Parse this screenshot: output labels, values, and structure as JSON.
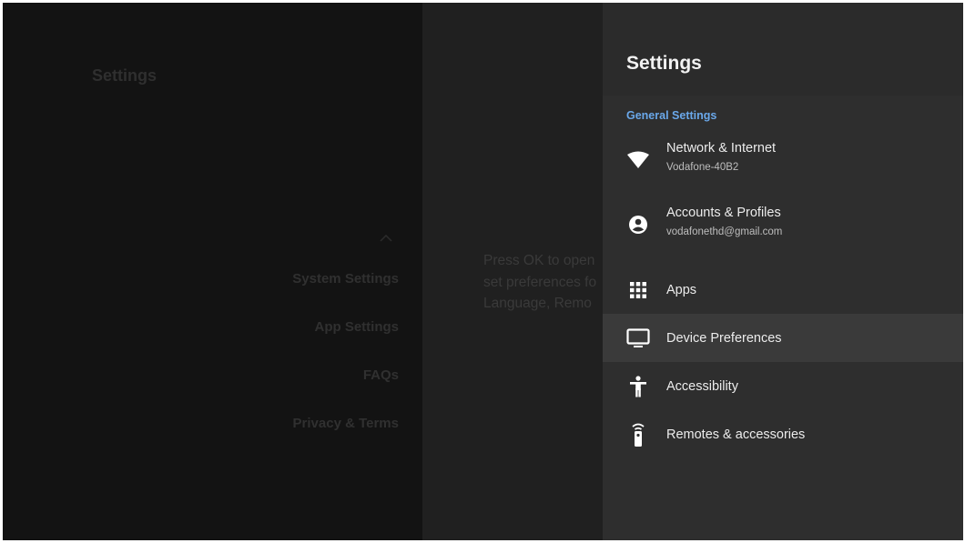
{
  "background": {
    "title": "Settings",
    "menu": [
      {
        "label": "System Settings"
      },
      {
        "label": "App Settings"
      },
      {
        "label": "FAQs"
      },
      {
        "label": "Privacy & Terms"
      }
    ],
    "description": [
      "Press OK to open",
      "set preferences fo",
      "Language, Remo"
    ]
  },
  "panel": {
    "title": "Settings",
    "section_label": "General Settings",
    "focused_item": "Device Preferences",
    "items": [
      {
        "label": "Network & Internet",
        "sub": "Vodafone-40B2",
        "icon": "wifi-icon"
      },
      {
        "label": "Accounts & Profiles",
        "sub": "vodafonethd@gmail.com",
        "icon": "account-icon"
      },
      {
        "label": "Apps",
        "icon": "apps-grid-icon"
      },
      {
        "label": "Device Preferences",
        "icon": "tv-icon"
      },
      {
        "label": "Accessibility",
        "icon": "accessibility-icon"
      },
      {
        "label": "Remotes & accessories",
        "icon": "remote-icon"
      }
    ]
  },
  "colors": {
    "accent": "#6aa8ea",
    "panel_bg": "#2e2e2e",
    "focus_bg": "#3a3a3a",
    "screen_bg": "#202020"
  }
}
